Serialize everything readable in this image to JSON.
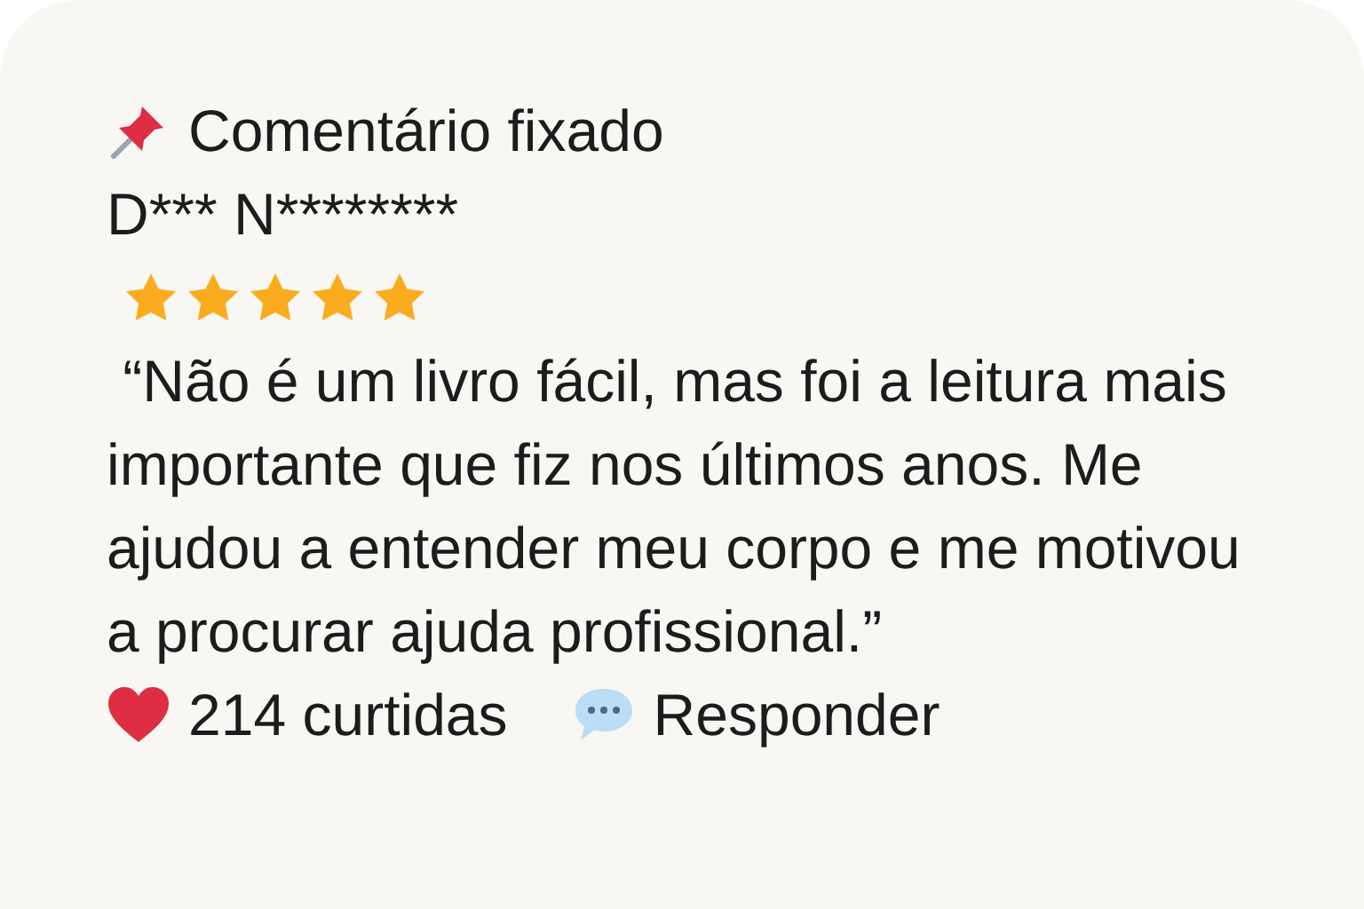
{
  "pinned_label": "Comentário fixado",
  "author": "D*** N********",
  "rating": {
    "stars": 5
  },
  "comment": " “Não é um livro fácil, mas foi a leitura mais importante que fiz nos últimos anos. Me ajudou a entender meu corpo e me motivou a procurar ajuda profissional.”",
  "likes": "214 curtidas",
  "reply": "Responder"
}
